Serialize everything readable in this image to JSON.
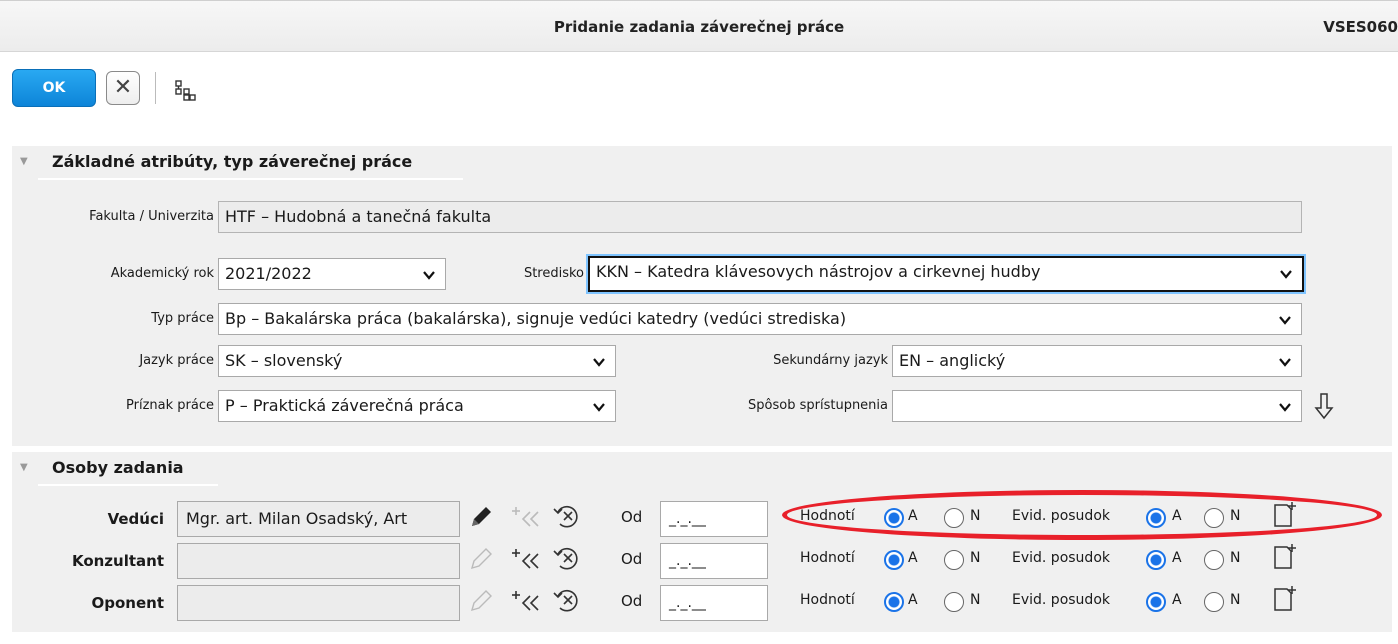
{
  "window": {
    "title": "Pridanie zadania záverečnej práce",
    "code": "VSES060"
  },
  "toolbar": {
    "ok_label": "OK",
    "close_glyph": "✕"
  },
  "section1": {
    "title": "Základné atribúty, typ záverečnej práce",
    "fakulta_label": "Fakulta / Univerzita",
    "fakulta_value": "HTF – Hudobná a tanečná fakulta",
    "rok_label": "Akademický rok",
    "rok_value": "2021/2022",
    "stredisko_label": "Stredisko",
    "stredisko_value": "KKN – Katedra klávesovych nástrojov a cirkevnej hudby",
    "typ_label": "Typ práce",
    "typ_value": "Bp – Bakalárska práca (bakalárska), signuje vedúci katedry (vedúci strediska)",
    "jazyk_label": "Jazyk práce",
    "jazyk_value": "SK – slovenský",
    "sek_jazyk_label": "Sekundárny jazyk",
    "sek_jazyk_value": "EN – anglický",
    "priznak_label": "Príznak práce",
    "priznak_value": "P – Praktická záverečná práca",
    "sposob_label": "Spôsob sprístupnenia",
    "sposob_value": ""
  },
  "section2": {
    "title": "Osoby zadania",
    "od_label": "Od",
    "date_placeholder": "_._.__",
    "hodnoti_label": "Hodnotí",
    "evid_label": "Evid. posudok",
    "opt_a": "A",
    "opt_n": "N",
    "persons": [
      {
        "label": "Vedúci",
        "value": "Mgr. art. Milan Osadský, Art",
        "hodnoti": "A",
        "evid": "A"
      },
      {
        "label": "Konzultant",
        "value": "",
        "hodnoti": "A",
        "evid": "A"
      },
      {
        "label": "Oponent",
        "value": "",
        "hodnoti": "A",
        "evid": "A"
      }
    ]
  },
  "colors": {
    "accent": "#1a73e8",
    "ok_button": "#1e97e8",
    "highlight": "#e8202a"
  }
}
